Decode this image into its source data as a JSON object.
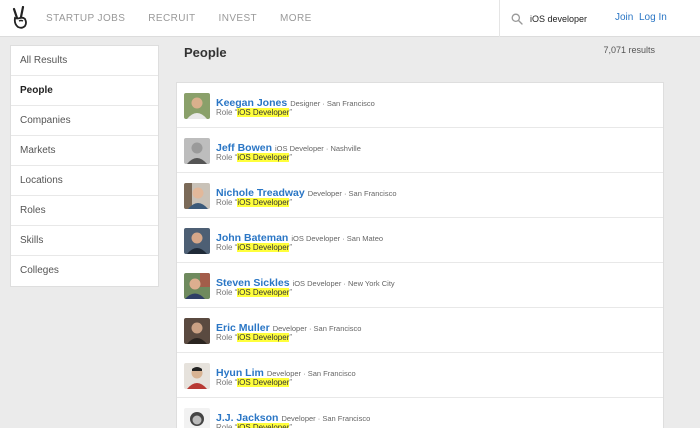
{
  "nav": {
    "items": [
      "STARTUP JOBS",
      "RECRUIT",
      "INVEST",
      "MORE"
    ]
  },
  "search": {
    "value": "iOS developer"
  },
  "auth": {
    "join": "Join",
    "login": "Log In"
  },
  "sidebar": {
    "items": [
      "All Results",
      "People",
      "Companies",
      "Markets",
      "Locations",
      "Roles",
      "Skills",
      "Colleges"
    ],
    "active": "People"
  },
  "main": {
    "title": "People",
    "result_count": "7,071 results"
  },
  "role_prefix": "Role “",
  "role_suffix": "”",
  "people": [
    {
      "name": "Keegan Jones",
      "meta": "Designer · San Francisco",
      "role": "iOS Developer"
    },
    {
      "name": "Jeff Bowen",
      "meta": "iOS Developer · Nashville",
      "role": "iOS Developer"
    },
    {
      "name": "Nichole Treadway",
      "meta": "Developer · San Francisco",
      "role": "iOS Developer"
    },
    {
      "name": "John Bateman",
      "meta": "iOS Developer · San Mateo",
      "role": "iOS Developer"
    },
    {
      "name": "Steven Sickles",
      "meta": "iOS Developer · New York City",
      "role": "iOS Developer"
    },
    {
      "name": "Eric Muller",
      "meta": "Developer · San Francisco",
      "role": "iOS Developer"
    },
    {
      "name": "Hyun Lim",
      "meta": "Developer · San Francisco",
      "role": "iOS Developer"
    },
    {
      "name": "J.J. Jackson",
      "meta": "Developer · San Francisco",
      "role": "iOS Developer"
    }
  ],
  "colors": {
    "link": "#2a76c5",
    "highlight": "#ffff3c",
    "page_bg": "#ebebeb"
  },
  "icons": {
    "logo": "peace-hand-icon",
    "search": "search-icon"
  }
}
